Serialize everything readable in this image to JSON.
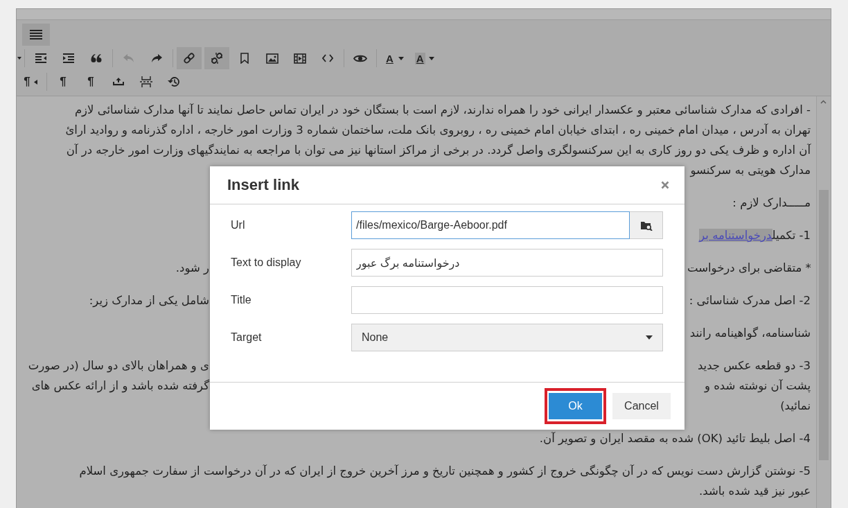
{
  "toolbar": {
    "menu_button": {
      "selected": true
    },
    "rows": [
      {
        "groups": [
          {
            "items": [
              {
                "kind": "background_color",
                "label": "A",
                "active": false,
                "disabled": false
              },
              {
                "kind": "text_color",
                "label": "A",
                "active": false,
                "disabled": false
              }
            ]
          },
          {
            "items": [
              {
                "kind": "preview",
                "active": false,
                "disabled": false
              }
            ]
          },
          {
            "items": [
              {
                "kind": "code",
                "active": false,
                "disabled": false
              },
              {
                "kind": "media",
                "active": false,
                "disabled": false
              },
              {
                "kind": "image",
                "active": false,
                "disabled": false
              },
              {
                "kind": "anchor",
                "active": false,
                "disabled": false
              },
              {
                "kind": "unlink",
                "active": true,
                "disabled": false
              },
              {
                "kind": "link",
                "active": true,
                "disabled": false
              }
            ]
          },
          {
            "items": [
              {
                "kind": "redo",
                "active": false,
                "disabled": false
              },
              {
                "kind": "undo",
                "active": false,
                "disabled": true
              }
            ]
          },
          {
            "items": [
              {
                "kind": "blockquote",
                "active": false,
                "disabled": false
              },
              {
                "kind": "indent",
                "active": false,
                "disabled": false
              },
              {
                "kind": "outdent",
                "active": false,
                "disabled": false
              }
            ]
          },
          {
            "items": [
              {
                "kind": "caret",
                "active": false,
                "disabled": false
              }
            ]
          }
        ]
      },
      {
        "groups": [
          {
            "items": [
              {
                "kind": "restore",
                "active": false,
                "disabled": false
              },
              {
                "kind": "pagebreak",
                "active": false,
                "disabled": false
              },
              {
                "kind": "insert",
                "active": false,
                "disabled": false
              },
              {
                "kind": "paragraph",
                "label": "¶",
                "active": false,
                "disabled": false
              },
              {
                "kind": "paragraph",
                "label": "¶",
                "active": false,
                "disabled": false
              }
            ]
          },
          {
            "items": [
              {
                "kind": "paragraph_ltr",
                "label": "¶",
                "active": false,
                "disabled": false
              }
            ]
          }
        ]
      }
    ]
  },
  "content": {
    "paragraphs": [
      {
        "lines": [
          {
            "kind": "full",
            "text": "- افرادی که مدارک شناسائی معتبر و عکسدار ایرانی خود را همراه ندارند، لازم است با بستگان خود در ایران تماس حاصل نمایند تا آنها مدارک شناسائی لازم"
          },
          {
            "kind": "full",
            "text": "تهران به آدرس ، میدان امام خمینی ره ، ابتدای خیابان امام خمینی ره ، روبروی بانک ملت، ساختمان شماره 3 وزارت امور خارجه ، اداره گذرنامه و روادید ارائ"
          },
          {
            "kind": "full",
            "text": "آن اداره و ظرف یکی دو روز کاری به این سرکنسولگری واصل گردد. در برخی از مراکز استانها نیز می توان با مراجعه به نمایندگیهای وزارت امور خارجه در آن"
          },
          {
            "kind": "split",
            "start": "مدارک هویتی به سرکنسو"
          }
        ]
      },
      {
        "lines": [
          {
            "kind": "split",
            "start": "مـــــدارک لازم :"
          }
        ]
      },
      {
        "lines": [
          {
            "kind": "split",
            "start": "1- تکمیل",
            "link": "درخواستنامه بر"
          }
        ]
      },
      {
        "lines": [
          {
            "kind": "split",
            "start": "* متقاضی برای درخواست",
            "end": "ر شود."
          }
        ]
      },
      {
        "lines": [
          {
            "kind": "split",
            "start": "2- اصل مدرک شناسائی :",
            "end": "شامل یکی از مدارک زیر:"
          }
        ]
      },
      {
        "lines": [
          {
            "kind": "split",
            "start": "شناسنامه، گواهینامه رانند"
          }
        ]
      },
      {
        "lines": [
          {
            "kind": "split",
            "start": "3- دو قطعه عکس جدید",
            "end": "ی و همراهان بالای دو سال (در صورت"
          },
          {
            "kind": "split",
            "start": "پشت آن نوشته شده و",
            "end": "گرفته شده باشد و از ارائه عکس های"
          },
          {
            "kind": "split",
            "start": "نمائید)"
          }
        ]
      },
      {
        "lines": [
          {
            "kind": "full",
            "text": "4- اصل بلیط تائید (OK) شده به مقصد ایران و تصویر آن."
          }
        ]
      },
      {
        "lines": [
          {
            "kind": "full",
            "text": "5- نوشتن گزارش دست نویس که در آن چگونگی خروج از کشور و همچنین تاریخ و مرز آخرین خروج از ایران که در آن  درخواست از سفارت جمهوری اسلام"
          },
          {
            "kind": "full",
            "text": "عبور نیز قید شده باشد."
          }
        ]
      }
    ]
  },
  "dialog": {
    "title": "Insert link",
    "fields": [
      {
        "kind": "url",
        "label": "Url",
        "value": "/files/mexico/Barge-Aeboor.pdf",
        "focused": true
      },
      {
        "kind": "text",
        "label": "Text to display",
        "value": "درخواستنامه برگ عبور",
        "focused": false
      },
      {
        "kind": "text",
        "label": "Title",
        "focused": false
      },
      {
        "kind": "select",
        "label": "Target",
        "value": "None",
        "focused": false
      }
    ],
    "buttons": [
      {
        "kind": "secondary",
        "label": "Cancel",
        "highlighted": false
      },
      {
        "kind": "primary",
        "label": "Ok",
        "highlighted": true
      }
    ]
  }
}
